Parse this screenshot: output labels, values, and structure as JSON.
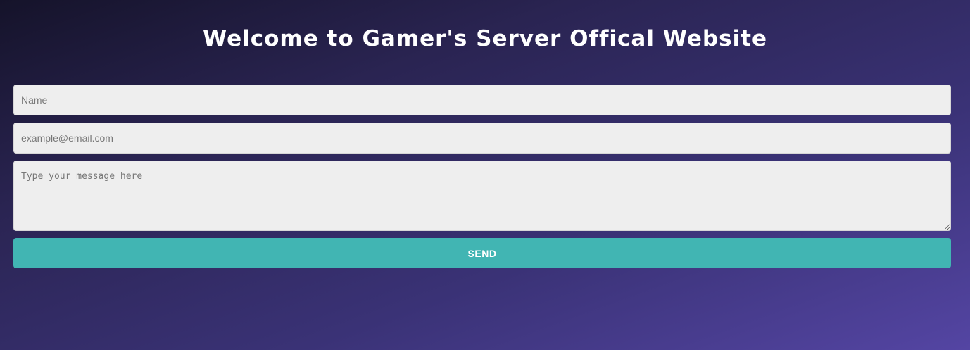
{
  "header": {
    "title": "Welcome to Gamer's Server Offical Website"
  },
  "form": {
    "name_placeholder": "Name",
    "email_placeholder": "example@email.com",
    "message_placeholder": "Type your message here",
    "send_label": "SEND"
  },
  "colors": {
    "accent": "#41b5b3",
    "field_background": "#eeeeee",
    "background_start": "#15132a",
    "background_end": "#5445a3"
  }
}
